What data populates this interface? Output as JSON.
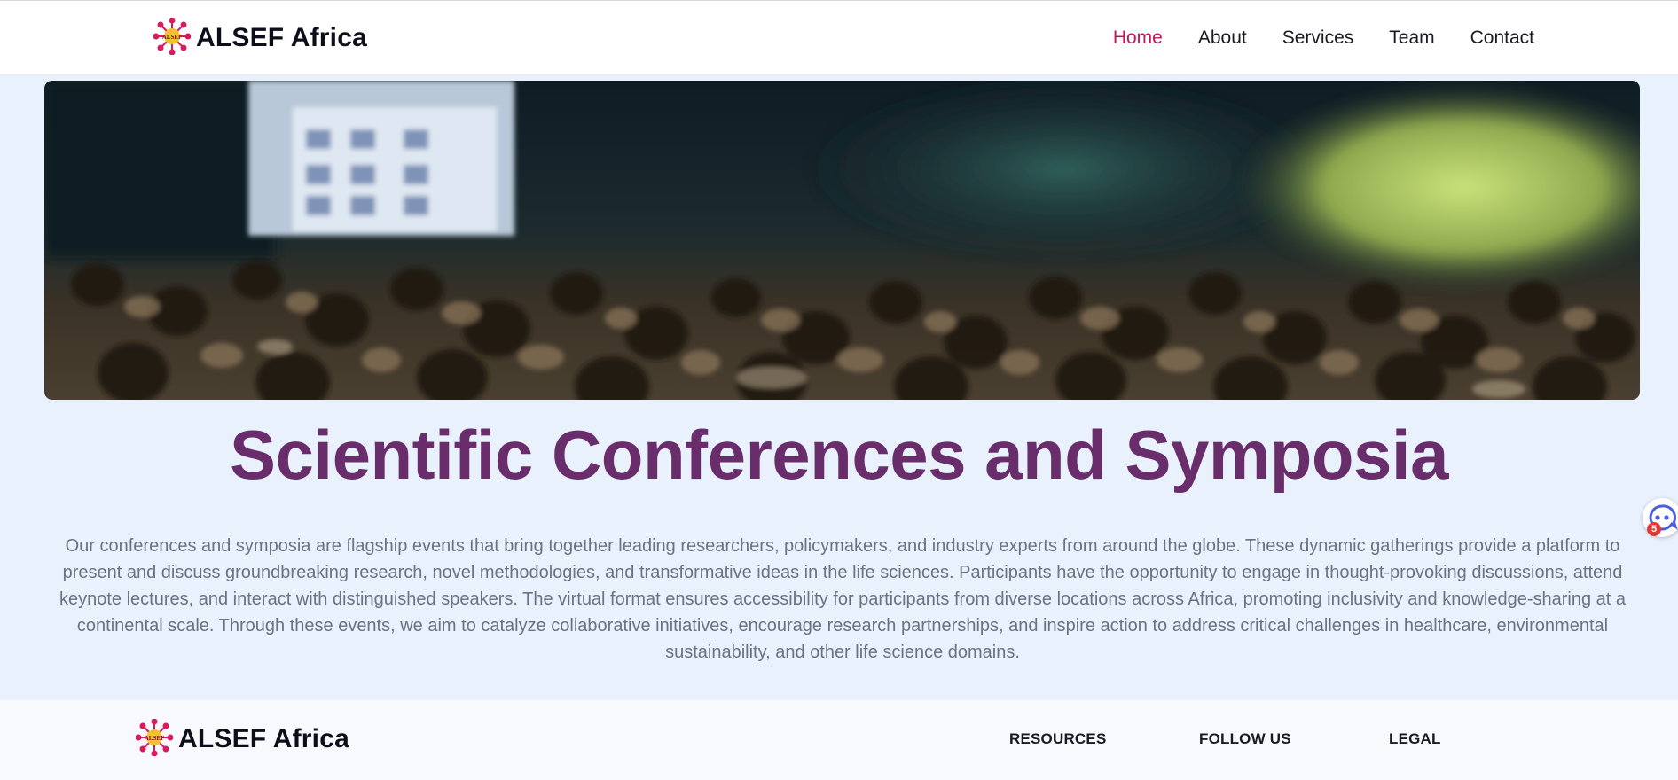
{
  "header": {
    "brand": "ALSEF Africa",
    "logo_text": "ALSEF",
    "nav": [
      {
        "label": "Home",
        "active": true
      },
      {
        "label": "About",
        "active": false
      },
      {
        "label": "Services",
        "active": false
      },
      {
        "label": "Team",
        "active": false
      },
      {
        "label": "Contact",
        "active": false
      }
    ]
  },
  "hero": {
    "image": "conference-audience-photo"
  },
  "main": {
    "title": "Scientific Conferences and Symposia",
    "description": "Our conferences and symposia are flagship events that bring together leading researchers, policymakers, and industry experts from around the globe. These dynamic gatherings provide a platform to present and discuss groundbreaking research, novel methodologies, and transformative ideas in the life sciences. Participants have the opportunity to engage in thought-provoking discussions, attend keynote lectures, and interact with distinguished speakers. The virtual format ensures accessibility for participants from diverse locations across Africa, promoting inclusivity and knowledge-sharing at a continental scale. Through these events, we aim to catalyze collaborative initiatives, encourage research partnerships, and inspire action to address critical challenges in healthcare, environmental sustainability, and other life science domains."
  },
  "chat_widget": {
    "icon": "chat-bot-icon",
    "badge_count": "5"
  },
  "footer": {
    "brand": "ALSEF Africa",
    "logo_text": "ALSEF",
    "columns": [
      "RESOURCES",
      "FOLLOW US",
      "LEGAL"
    ]
  },
  "colors": {
    "accent": "#c2185b",
    "title": "#6a2d6c",
    "page_bg": "#e8f1fc",
    "logo_magenta": "#d81b60",
    "logo_yellow": "#f2c230"
  }
}
